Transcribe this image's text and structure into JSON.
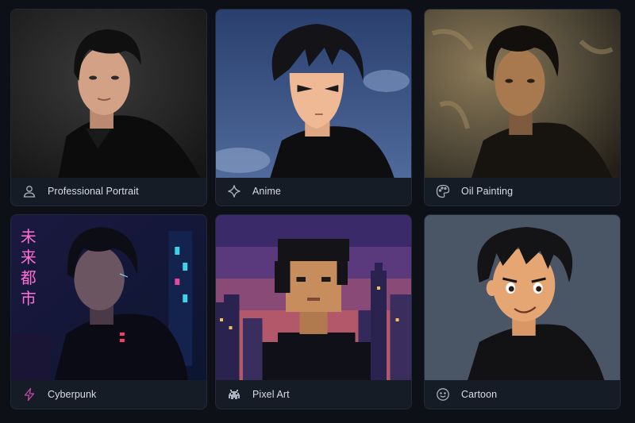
{
  "styles": [
    {
      "label": "Professional Portrait",
      "icon": "user-icon"
    },
    {
      "label": "Anime",
      "icon": "sparkle-icon"
    },
    {
      "label": "Oil Painting",
      "icon": "palette-icon"
    },
    {
      "label": "Cyberpunk",
      "icon": "lightning-icon"
    },
    {
      "label": "Pixel Art",
      "icon": "space-invader-icon"
    },
    {
      "label": "Cartoon",
      "icon": "smiley-icon"
    }
  ],
  "neon_sign": "未来都市",
  "colors": {
    "background": "#0d1117",
    "card": "#161c26",
    "label": "#d8dde6",
    "icon": "#aab2c0",
    "cyberpunk_accent": "#c24aa8"
  }
}
